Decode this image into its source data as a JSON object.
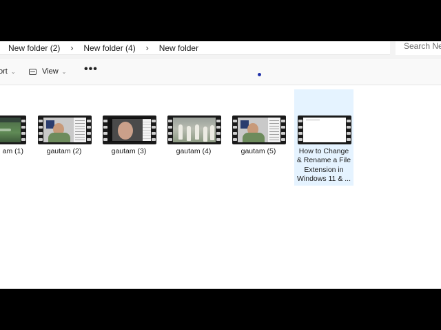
{
  "address": {
    "crumbs": [
      "New folder (2)",
      "New folder (4)",
      "New folder"
    ],
    "separator": "›"
  },
  "search": {
    "placeholder": "Search New"
  },
  "commandbar": {
    "sort_label": "ort",
    "view_label": "View",
    "more_label": "•••",
    "chevron": "⌄"
  },
  "files": [
    {
      "name": "am (1)",
      "thumb": "cricket-broadcast",
      "selected": false
    },
    {
      "name": "gautam (2)",
      "thumb": "person-screen",
      "selected": false
    },
    {
      "name": "gautam (3)",
      "thumb": "webcam-screen",
      "selected": false
    },
    {
      "name": "gautam (4)",
      "thumb": "cricket-players",
      "selected": false
    },
    {
      "name": "gautam (5)",
      "thumb": "person-screen",
      "selected": false
    },
    {
      "name": "How to Change & Rename a File Extension in Windows 11 & ...",
      "thumb": "blank-document",
      "selected": true
    }
  ],
  "colors": {
    "selection": "#e5f3ff",
    "filmstrip": "#1a1a1a",
    "cursor": "#2233aa"
  }
}
